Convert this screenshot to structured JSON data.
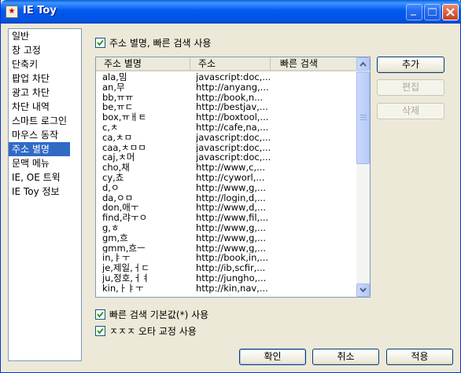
{
  "window": {
    "title": "IE Toy"
  },
  "nav": {
    "items": [
      "일반",
      "창 고정",
      "단축키",
      "팝업 차단",
      "광고 차단",
      "차단 내역",
      "스마트 로그인",
      "마우스 동작",
      "주소 별명",
      "문맥 메뉴",
      "IE, OE 트윅",
      "IE Toy 정보"
    ],
    "selected": 8
  },
  "options": {
    "use_alias_label": "주소 별명, 빠른 검색 사용",
    "use_alias_checked": true,
    "default_search_label": "빠른 검색 기본값(*) 사용",
    "default_search_checked": true,
    "typo_fix_label": "ㅈㅈㅈ 오타 교정 사용",
    "typo_fix_checked": true
  },
  "table": {
    "columns": [
      "주소 별명",
      "주소",
      "빠른 검색"
    ],
    "rows": [
      [
        "ala,밈",
        "javascript:doc,..."
      ],
      [
        "an,무",
        "http://anyang,..."
      ],
      [
        "bb,ㅠㅠ",
        "http://book,n..."
      ],
      [
        "be,ㅠㄷ",
        "http://bestjav,..."
      ],
      [
        "box,ㅠㅐㅌ",
        "http://boxtool,..."
      ],
      [
        "c,ㅊ",
        "http://cafe,na,..."
      ],
      [
        "ca,ㅊㅁ",
        "javascript:doc,..."
      ],
      [
        "caa,ㅊㅁㅁ",
        "javascript:doc,..."
      ],
      [
        "caj,ㅊ머",
        "javascript:doc,..."
      ],
      [
        "cho,채",
        "http://www,c,..."
      ],
      [
        "cy,쵸",
        "http://cyworl,..."
      ],
      [
        "d,ㅇ",
        "http://www,g,..."
      ],
      [
        "da,ㅇㅁ",
        "http://login,d,..."
      ],
      [
        "don,애ㅜ",
        "http://www,d,..."
      ],
      [
        "find,랴ㅜㅇ",
        "http://www,fil,..."
      ],
      [
        "g,ㅎ",
        "http://www,g,..."
      ],
      [
        "gm,흐",
        "http://www,g,..."
      ],
      [
        "gmm,흐ㅡ",
        "http://www,g,..."
      ],
      [
        "in,ㅑㅜ",
        "http://book,in,..."
      ],
      [
        "je,제일,ㅓㄷ",
        "http://ib,scfir,..."
      ],
      [
        "ju,정호,ㅓㅕ",
        "http://jungho,..."
      ],
      [
        "kin,ㅏㅑㅜ",
        "http://kin,nav,..."
      ]
    ]
  },
  "side_buttons": {
    "add": "추가",
    "edit": "편집",
    "delete": "삭제"
  },
  "footer": {
    "ok": "확인",
    "cancel": "취소",
    "apply": "적용"
  }
}
